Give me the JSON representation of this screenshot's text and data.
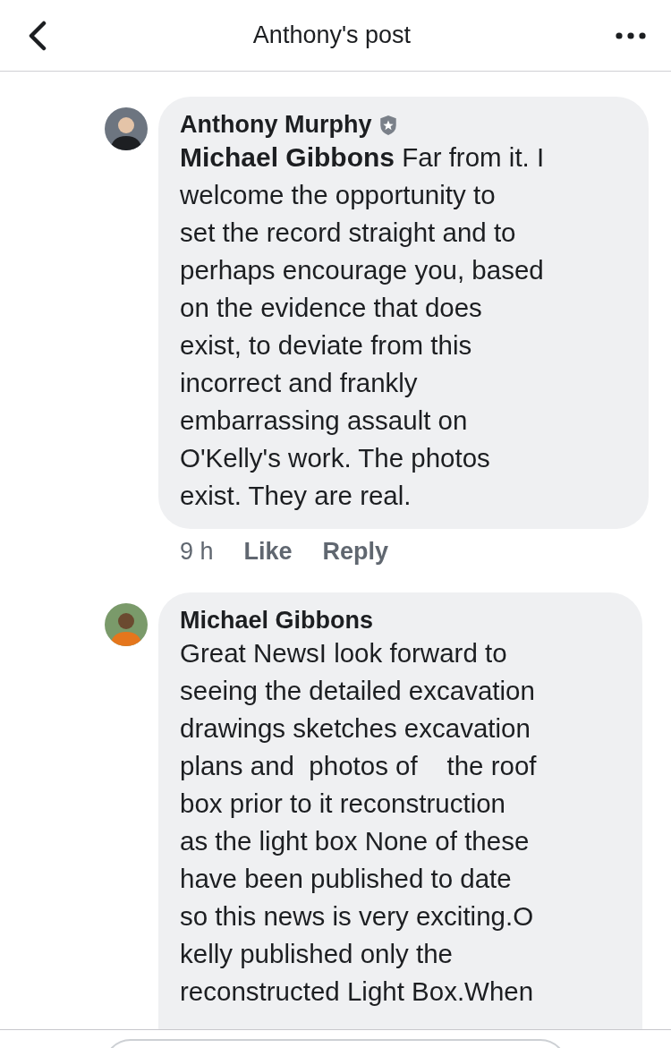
{
  "header": {
    "title": "Anthony's post"
  },
  "comments": [
    {
      "author": "Anthony Murphy",
      "badge": true,
      "text": "**Michael Gibbons** Far from it. I\nwelcome the opportunity to\nset the record straight and to\nperhaps encourage you, based\non the evidence that does\nexist, to deviate from this\nincorrect and frankly\nembarrassing assault on\nO'Kelly's work. The photos\nexist. They are real.",
      "time": "9 h",
      "actions": [
        "Like",
        "Reply"
      ]
    },
    {
      "author": "Michael Gibbons",
      "badge": false,
      "text": "Great NewsI look forward to\nseeing the detailed excavation\ndrawings sketches excavation\nplans and  photos of    the roof\nbox prior to it reconstruction\nas the light box None of these\nhave been published to date\nso this news is very exciting.O\nkelly published only the\nreconstructed Light Box.When"
    }
  ]
}
